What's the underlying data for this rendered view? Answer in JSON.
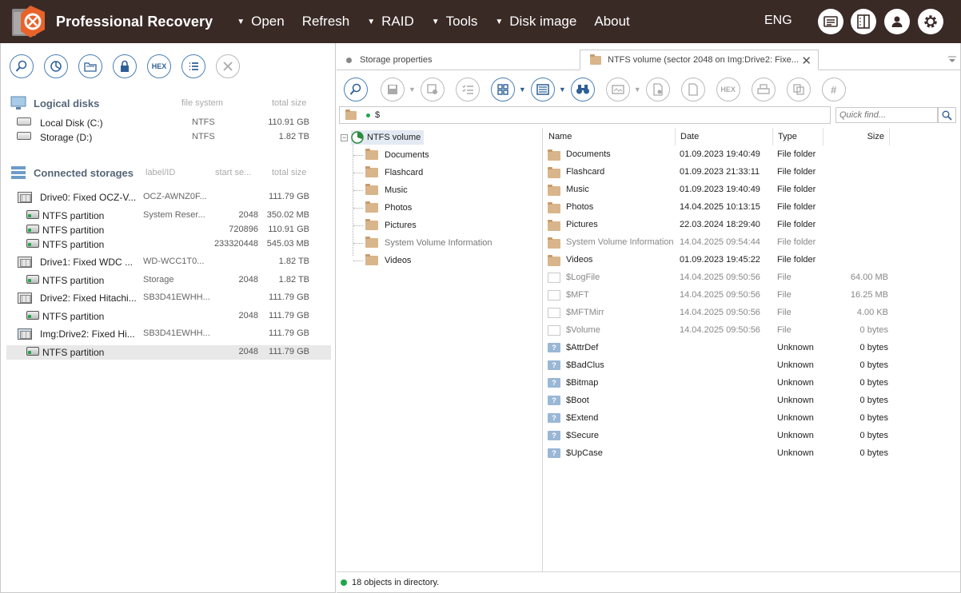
{
  "app": {
    "title": "Professional Recovery",
    "lang": "ENG"
  },
  "menu": [
    {
      "label": "Open",
      "dropdown": true
    },
    {
      "label": "Refresh",
      "dropdown": false
    },
    {
      "label": "RAID",
      "dropdown": true
    },
    {
      "label": "Tools",
      "dropdown": true
    },
    {
      "label": "Disk image",
      "dropdown": true
    },
    {
      "label": "About",
      "dropdown": false
    }
  ],
  "left": {
    "toolbar_hex": "HEX",
    "logical": {
      "title": "Logical disks",
      "col_fs": "file system",
      "col_size": "total size",
      "items": [
        {
          "name": "Local Disk (C:)",
          "fs": "NTFS",
          "size": "110.91 GB"
        },
        {
          "name": "Storage (D:)",
          "fs": "NTFS",
          "size": "1.82 TB"
        }
      ]
    },
    "connected": {
      "title": "Connected storages",
      "col_label": "label/ID",
      "col_start": "start se...",
      "col_size": "total size",
      "items": [
        {
          "kind": "drive",
          "name": "Drive0: Fixed OCZ-V...",
          "label": "OCZ-AWNZ0F...",
          "start": "",
          "size": "111.79 GB"
        },
        {
          "kind": "part",
          "name": "NTFS partition",
          "label": "System Reser...",
          "start": "2048",
          "size": "350.02 MB"
        },
        {
          "kind": "part",
          "name": "NTFS partition",
          "label": "",
          "start": "720896",
          "size": "110.91 GB"
        },
        {
          "kind": "part",
          "name": "NTFS partition",
          "label": "",
          "start": "233320448",
          "size": "545.03 MB"
        },
        {
          "kind": "drive",
          "name": "Drive1: Fixed WDC ...",
          "label": "WD-WCC1T0...",
          "start": "",
          "size": "1.82 TB"
        },
        {
          "kind": "part",
          "name": "NTFS partition",
          "label": "Storage",
          "start": "2048",
          "size": "1.82 TB"
        },
        {
          "kind": "drive",
          "name": "Drive2: Fixed Hitachi...",
          "label": "SB3D41EWHH...",
          "start": "",
          "size": "111.79 GB"
        },
        {
          "kind": "part",
          "name": "NTFS partition",
          "label": "",
          "start": "2048",
          "size": "111.79 GB"
        },
        {
          "kind": "img",
          "name": "Img:Drive2: Fixed Hi...",
          "label": "SB3D41EWHH...",
          "start": "",
          "size": "111.79 GB"
        },
        {
          "kind": "part",
          "name": "NTFS partition",
          "label": "",
          "start": "2048",
          "size": "111.79 GB"
        }
      ]
    }
  },
  "tabs": [
    {
      "label": "Storage properties"
    },
    {
      "label": "NTFS volume (sector 2048 on Img:Drive2: Fixe..."
    }
  ],
  "toolbar": {
    "hex": "HEX",
    "hash": "#"
  },
  "path": {
    "value": "$"
  },
  "search": {
    "placeholder": "Quick find..."
  },
  "tree": {
    "root": "NTFS volume",
    "children": [
      {
        "name": "Documents",
        "muted": false
      },
      {
        "name": "Flashcard",
        "muted": false
      },
      {
        "name": "Music",
        "muted": false
      },
      {
        "name": "Photos",
        "muted": false
      },
      {
        "name": "Pictures",
        "muted": false
      },
      {
        "name": "System Volume Information",
        "muted": true
      },
      {
        "name": "Videos",
        "muted": false
      }
    ]
  },
  "list": {
    "headers": {
      "name": "Name",
      "date": "Date",
      "type": "Type",
      "size": "Size"
    },
    "rows": [
      {
        "icon": "folder",
        "name": "Documents",
        "date": "01.09.2023 19:40:49",
        "type": "File folder",
        "size": "",
        "muted": false
      },
      {
        "icon": "folder",
        "name": "Flashcard",
        "date": "01.09.2023 21:33:11",
        "type": "File folder",
        "size": "",
        "muted": false
      },
      {
        "icon": "folder",
        "name": "Music",
        "date": "01.09.2023 19:40:49",
        "type": "File folder",
        "size": "",
        "muted": false
      },
      {
        "icon": "folder",
        "name": "Photos",
        "date": "14.04.2025 10:13:15",
        "type": "File folder",
        "size": "",
        "muted": false
      },
      {
        "icon": "folder",
        "name": "Pictures",
        "date": "22.03.2024 18:29:40",
        "type": "File folder",
        "size": "",
        "muted": false
      },
      {
        "icon": "folder",
        "name": "System Volume Information",
        "date": "14.04.2025 09:54:44",
        "type": "File folder",
        "size": "",
        "muted": true
      },
      {
        "icon": "folder",
        "name": "Videos",
        "date": "01.09.2023 19:45:22",
        "type": "File folder",
        "size": "",
        "muted": false
      },
      {
        "icon": "file",
        "name": "$LogFile",
        "date": "14.04.2025 09:50:56",
        "type": "File",
        "size": "64.00 MB",
        "muted": true
      },
      {
        "icon": "file",
        "name": "$MFT",
        "date": "14.04.2025 09:50:56",
        "type": "File",
        "size": "16.25 MB",
        "muted": true
      },
      {
        "icon": "file",
        "name": "$MFTMirr",
        "date": "14.04.2025 09:50:56",
        "type": "File",
        "size": "4.00 KB",
        "muted": true
      },
      {
        "icon": "file",
        "name": "$Volume",
        "date": "14.04.2025 09:50:56",
        "type": "File",
        "size": "0 bytes",
        "muted": true
      },
      {
        "icon": "unknown",
        "name": "$AttrDef",
        "date": "",
        "type": "Unknown",
        "size": "0 bytes",
        "muted": false
      },
      {
        "icon": "unknown",
        "name": "$BadClus",
        "date": "",
        "type": "Unknown",
        "size": "0 bytes",
        "muted": false
      },
      {
        "icon": "unknown",
        "name": "$Bitmap",
        "date": "",
        "type": "Unknown",
        "size": "0 bytes",
        "muted": false
      },
      {
        "icon": "unknown",
        "name": "$Boot",
        "date": "",
        "type": "Unknown",
        "size": "0 bytes",
        "muted": false
      },
      {
        "icon": "unknown",
        "name": "$Extend",
        "date": "",
        "type": "Unknown",
        "size": "0 bytes",
        "muted": false
      },
      {
        "icon": "unknown",
        "name": "$Secure",
        "date": "",
        "type": "Unknown",
        "size": "0 bytes",
        "muted": false
      },
      {
        "icon": "unknown",
        "name": "$UpCase",
        "date": "",
        "type": "Unknown",
        "size": "0 bytes",
        "muted": false
      }
    ]
  },
  "status": {
    "text": "18 objects in directory."
  }
}
